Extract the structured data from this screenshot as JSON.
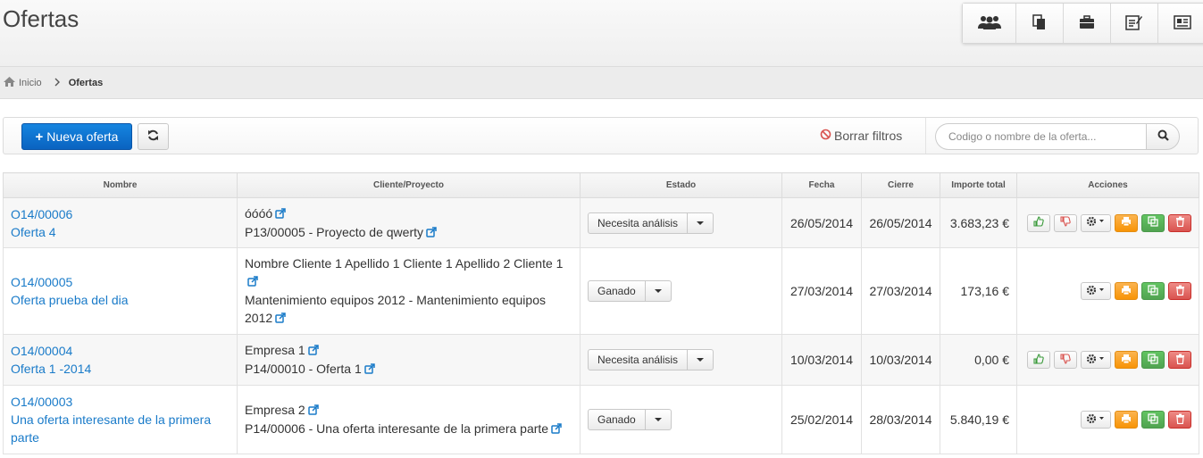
{
  "header": {
    "title": "Ofertas",
    "quick_nav": [
      {
        "icon": "users-icon"
      },
      {
        "icon": "documents-icon"
      },
      {
        "icon": "briefcase-icon"
      },
      {
        "icon": "edit-icon"
      },
      {
        "icon": "contact-card-icon"
      }
    ]
  },
  "breadcrumb": {
    "home": "Inicio",
    "current": "Ofertas"
  },
  "toolbar": {
    "new_label": "Nueva oferta",
    "clear_filters_label": "Borrar filtros",
    "search_placeholder": "Codigo o nombre de la oferta..."
  },
  "table": {
    "columns": [
      "Nombre",
      "Cliente/Proyecto",
      "Estado",
      "Fecha",
      "Cierre",
      "Importe total",
      "Acciones"
    ],
    "rows": [
      {
        "code": "O14/00006",
        "name": "Oferta 4",
        "client": "óóóó",
        "project": "P13/00005 - Proyecto de qwerty",
        "state": "Necesita análisis",
        "date": "26/05/2014",
        "close": "26/05/2014",
        "total": "3.683,23 €",
        "show_vote": true
      },
      {
        "code": "O14/00005",
        "name": "Oferta prueba del dia",
        "client": "Nombre Cliente 1 Apellido 1 Cliente 1 Apellido 2 Cliente 1",
        "project": "Mantenimiento equipos 2012 - Mantenimiento equipos 2012",
        "state": "Ganado",
        "date": "27/03/2014",
        "close": "27/03/2014",
        "total": "173,16 €",
        "show_vote": false
      },
      {
        "code": "O14/00004",
        "name": "Oferta 1 -2014",
        "client": "Empresa 1",
        "project": "P14/00010 - Oferta 1",
        "state": "Necesita análisis",
        "date": "10/03/2014",
        "close": "10/03/2014",
        "total": "0,00 €",
        "show_vote": true
      },
      {
        "code": "O14/00003",
        "name": "Una oferta interesante de la primera parte",
        "client": "Empresa 2",
        "project": "P14/00006 - Una oferta interesante de la primera parte",
        "state": "Ganado",
        "date": "25/02/2014",
        "close": "28/03/2014",
        "total": "5.840,19 €",
        "show_vote": false
      }
    ]
  },
  "colors": {
    "primary": "#0a6ccc",
    "link": "#1a7bc9",
    "print": "#f89406",
    "copy": "#51a351",
    "delete": "#d9534f"
  }
}
